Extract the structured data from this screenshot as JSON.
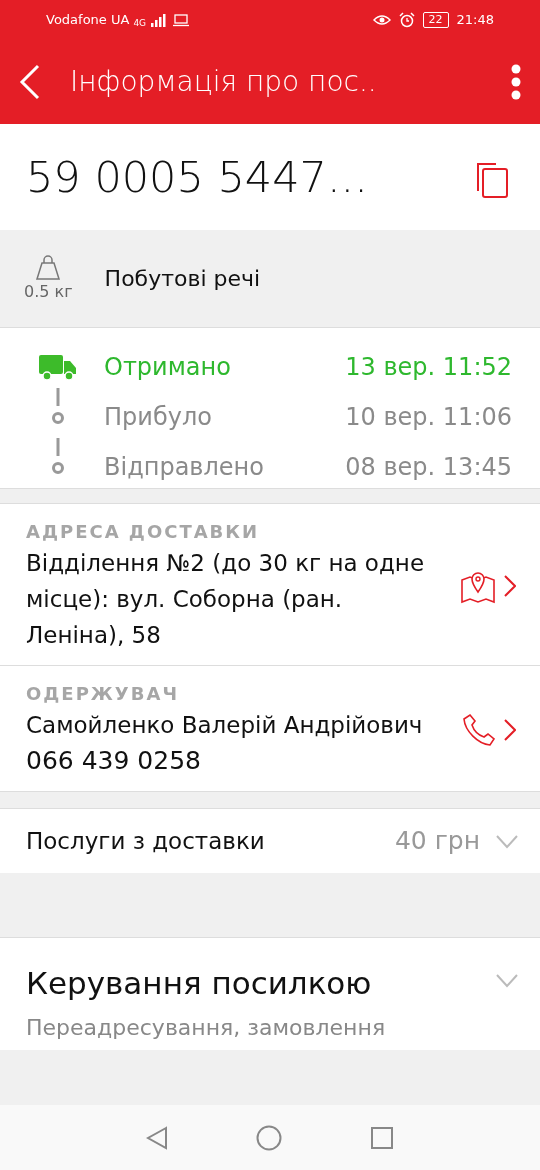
{
  "status_bar": {
    "carrier": "Vodafone UA",
    "network": "4G",
    "battery": "22",
    "time": "21:48"
  },
  "app_bar": {
    "title": "Інформація про пос.."
  },
  "parcel": {
    "number": "59 0005 5447..."
  },
  "cargo": {
    "weight": "0.5 кг",
    "description": "Побутові речі"
  },
  "tracking": [
    {
      "status": "Отримано",
      "date": "13 вер. 11:52",
      "current": true
    },
    {
      "status": "Прибуло",
      "date": "10 вер. 11:06",
      "current": false
    },
    {
      "status": "Відправлено",
      "date": "08 вер. 13:45",
      "current": false
    }
  ],
  "details": [
    {
      "kind": "address",
      "label": "АДРЕСА ДОСТАВКИ",
      "lines": [
        "Відділення №2 (до 30 кг на одне місце): вул. Соборна (ран. Леніна), 58"
      ]
    },
    {
      "kind": "recipient",
      "label": "ОДЕРЖУВАЧ",
      "lines": [
        "Самойленко Валерій Андрійович",
        "066 439 0258"
      ]
    }
  ],
  "services": {
    "label": "Послуги з доставки",
    "price": "40 грн",
    "expanded": false
  },
  "management": {
    "title": "Керування посилкою",
    "subtitle": "Переадресування, замовлення",
    "expanded": false
  }
}
